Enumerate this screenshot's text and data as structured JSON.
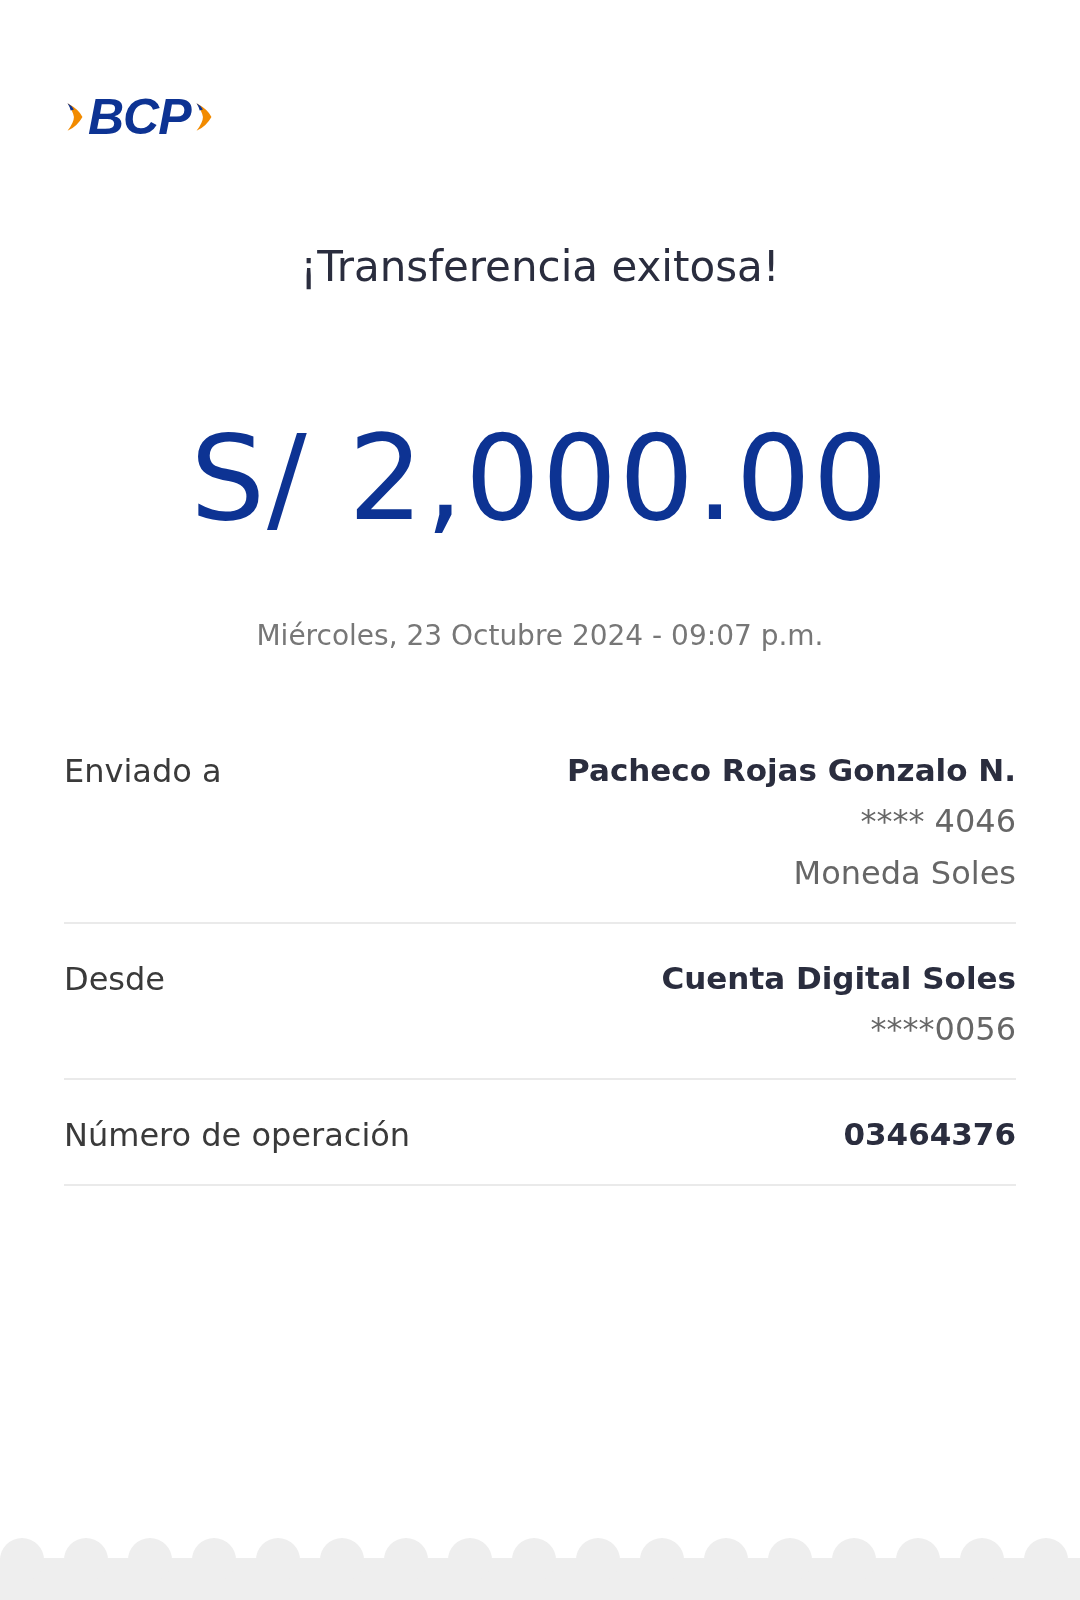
{
  "logo": {
    "text": "BCP"
  },
  "title": "¡Transferencia exitosa!",
  "amount": "S/ 2,000.00",
  "datetime": "Miércoles, 23 Octubre 2024 - 09:07 p.m.",
  "details": [
    {
      "label": "Enviado a",
      "lines": [
        "Pacheco Rojas Gonzalo N.",
        "**** 4046",
        "Moneda Soles"
      ]
    },
    {
      "label": "Desde",
      "lines": [
        "Cuenta Digital Soles",
        "****0056"
      ]
    },
    {
      "label": "Número de operación",
      "lines": [
        "03464376"
      ]
    }
  ]
}
